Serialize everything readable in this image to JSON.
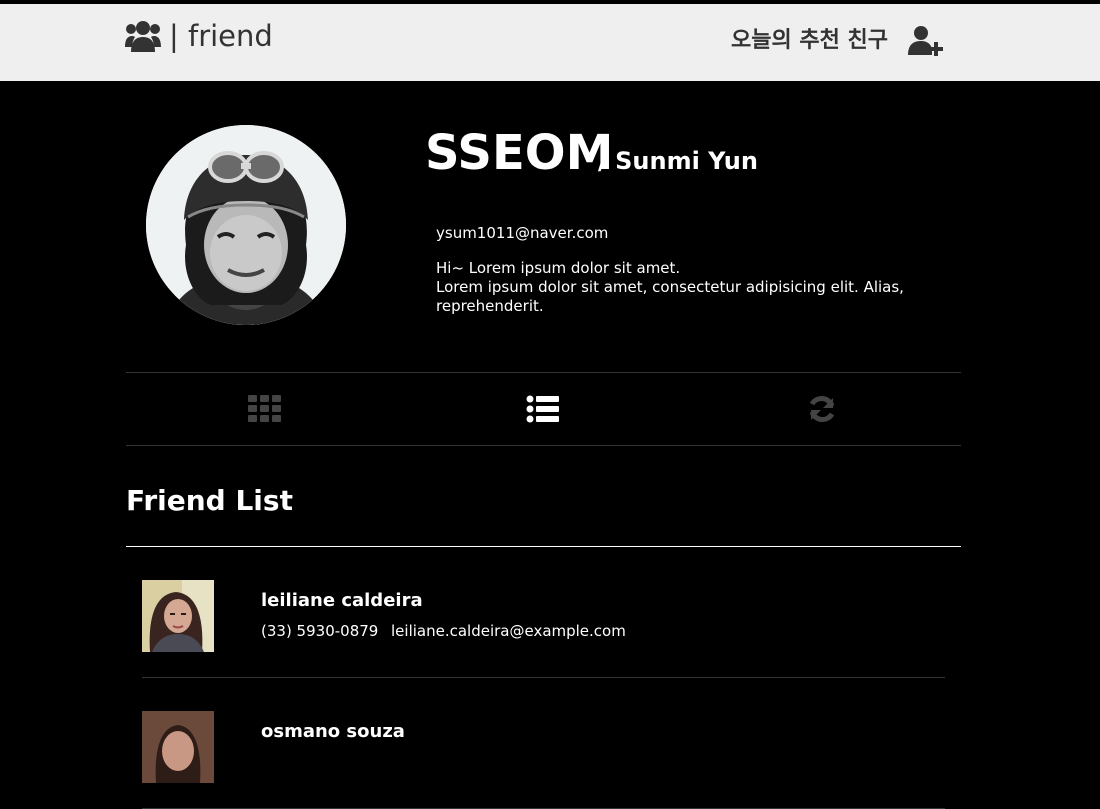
{
  "navbar": {
    "brand_text": "| friend",
    "brand_icon": "users-icon",
    "recommend_label": "오늘의 추천 친구",
    "add_friend_icon": "user-plus-icon",
    "background": "#efefef",
    "text_color": "#333333"
  },
  "profile": {
    "nickname": "SSEOM",
    "realname": "/ Sunmi Yun",
    "email": "ysum1011@naver.com",
    "bio_line1": "Hi~ Lorem ipsum dolor sit amet.",
    "bio_line2": "Lorem ipsum dolor sit amet, consectetur adipisicing elit. Alias, reprehenderit."
  },
  "view_tabs": [
    {
      "icon": "grid-icon",
      "active": false
    },
    {
      "icon": "list-icon",
      "active": true
    },
    {
      "icon": "refresh-icon",
      "active": false
    }
  ],
  "friend_list": {
    "title": "Friend List",
    "items": [
      {
        "name": "leiliane caldeira",
        "phone": "(33) 5930-0879",
        "email": "leiliane.caldeira@example.com"
      },
      {
        "name": "osmano souza",
        "phone": "",
        "email": ""
      }
    ]
  },
  "colors": {
    "page_background": "#000000",
    "active_tab_icon": "#ffffff",
    "inactive_tab_icon": "#444444"
  }
}
